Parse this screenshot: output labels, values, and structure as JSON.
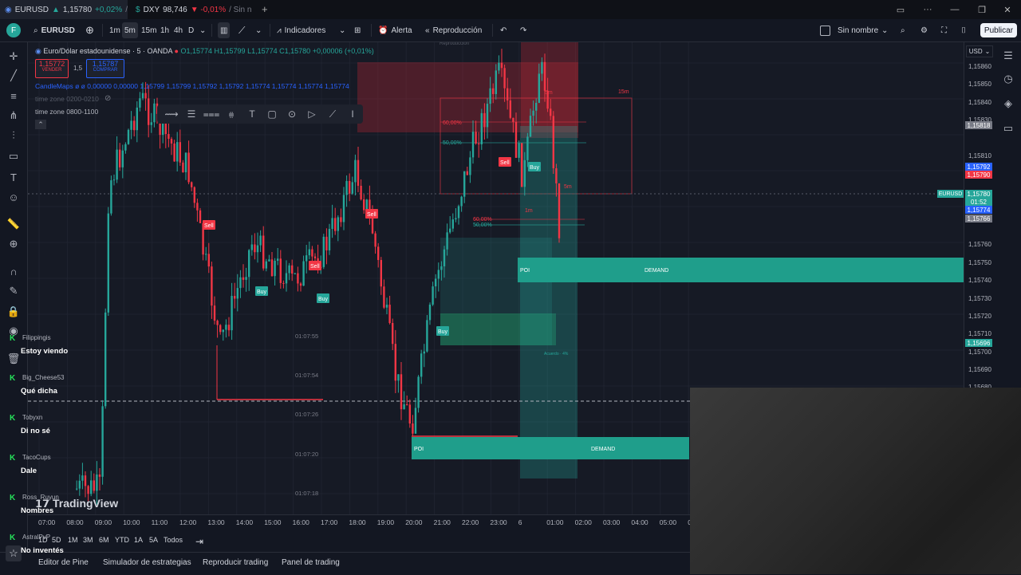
{
  "browser_tabs": [
    {
      "symbol": "EURUSD",
      "price": "1,15780",
      "change": "+0,02%",
      "suffix": "/"
    },
    {
      "symbol": "DXY",
      "price": "98,746",
      "change": "▼ -0,01%",
      "suffix": "/ Sin n"
    }
  ],
  "toolbar": {
    "symbol": "EURUSD",
    "intervals": [
      "1m",
      "5m",
      "15m",
      "1h",
      "4h",
      "D"
    ],
    "indicators_label": "Indicadores",
    "alert_label": "Alerta",
    "replay_label": "Reproducción",
    "layout_name": "Sin nombre",
    "publish_label": "Publicar",
    "replay_hint": "Reproducción"
  },
  "chart": {
    "title": "Euro/Dólar estadounidense · 5 · OANDA",
    "ohlc": {
      "o": "O1,15774",
      "h": "H1,15799",
      "l": "L1,15774",
      "c": "C1,15780",
      "chg": "+0,00006 (+0,01%)"
    },
    "sell": {
      "price": "1,15772",
      "label": "VENDER"
    },
    "spread": "1,5",
    "buy": {
      "price": "1,15787",
      "label": "COMPRAR"
    },
    "indicator_line": "CandleMaps  ø  ø  0,00000  0,00000  1,15799  1,15799  1,15792  1,15792  1,15774  1,15774  1,15774  1,15774",
    "time_zone_1": "time zone 0200-0210",
    "time_zone_2": "time zone 0800-1100",
    "currency": "USD",
    "watermark": "TradingView",
    "zones": [
      {
        "label": "POI",
        "tag": "DEMAND"
      },
      {
        "label": "POI",
        "tag": "DEMAND"
      }
    ],
    "fib_labels": [
      "60,00%",
      "50,00%",
      "60,00%",
      "50,00%"
    ],
    "tf_labels": [
      "15m",
      "5m",
      "5m",
      "1m"
    ],
    "signals": [
      "Sell",
      "Sell",
      "Sell",
      "Sell",
      "Buy",
      "Buy",
      "Buy",
      "Buy"
    ],
    "timestamps": [
      "01:07:55",
      "01:07:54",
      "01:07:26",
      "01:07:20",
      "01:07:18"
    ],
    "note_small": "Acuerdo · 4%"
  },
  "price_scale": {
    "labels": [
      "1,15860",
      "1,15850",
      "1,15840",
      "1,15830",
      "1,15810",
      "1,15800",
      "1,15760",
      "1,15750",
      "1,15740",
      "1,15730",
      "1,15720",
      "1,15710",
      "1,15700",
      "1,15690",
      "1,15680",
      "1,15670"
    ],
    "tags": [
      {
        "value": "1,15818",
        "color": "#787b86"
      },
      {
        "value": "1,15792",
        "color": "#2962ff"
      },
      {
        "value": "1,15790",
        "color": "#f23645"
      },
      {
        "value": "1,15780",
        "color": "#26a69a"
      },
      {
        "value": "01:52",
        "color": "#26a69a"
      },
      {
        "value": "1,15774",
        "color": "#2962ff"
      },
      {
        "value": "1,15766",
        "color": "#787b86"
      },
      {
        "value": "1,15696",
        "color": "#26a69a"
      }
    ],
    "symbol_tag": "EURUSD"
  },
  "time_axis": [
    "07:00",
    "08:00",
    "09:00",
    "10:00",
    "11:00",
    "12:00",
    "13:00",
    "14:00",
    "15:00",
    "16:00",
    "17:00",
    "18:00",
    "19:00",
    "20:00",
    "21:00",
    "22:00",
    "23:00",
    "6",
    "01:00",
    "02:00",
    "03:00",
    "04:00",
    "05:00",
    "0"
  ],
  "ranges": [
    "1D",
    "5D",
    "1M",
    "3M",
    "6M",
    "YTD",
    "1A",
    "5A",
    "Todos"
  ],
  "bottom_tabs": [
    "Editor de Pine",
    "Simulador de estrategias",
    "Reproducir trading",
    "Panel de trading"
  ],
  "chat": [
    {
      "user": "Filippingis",
      "message": "Estoy viendo"
    },
    {
      "user": "Big_Cheese53",
      "message": "Qué dicha"
    },
    {
      "user": "Tobyxn",
      "message": "Di no sé"
    },
    {
      "user": "TacoCups",
      "message": "Dale"
    },
    {
      "user": "Ross_Ruyun",
      "message": "Nombres"
    },
    {
      "user": "AstralPvP",
      "message": "No inventés"
    }
  ],
  "colors": {
    "up": "#26a69a",
    "down": "#f23645",
    "accent": "#2962ff",
    "bg": "#131722"
  }
}
